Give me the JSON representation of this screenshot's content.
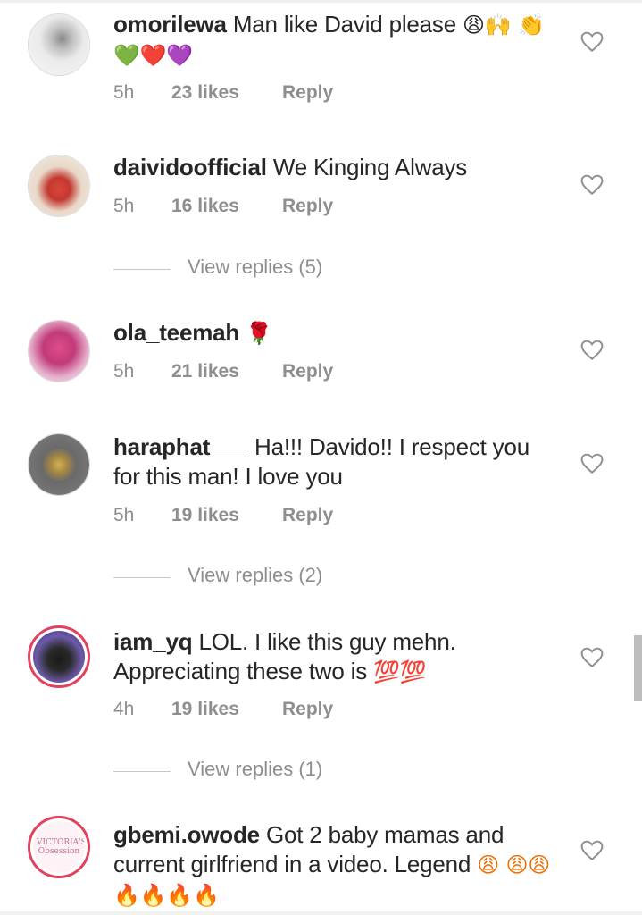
{
  "comments": [
    {
      "username": "omorilewa",
      "text": "Man like David please",
      "emojis": "😩🙌 👏💚❤️💜",
      "time": "5h",
      "likes": "23 likes",
      "reply": "Reply"
    },
    {
      "username": "daividoofficial",
      "text": "We Kinging Always",
      "emojis": "",
      "time": "5h",
      "likes": "16 likes",
      "reply": "Reply",
      "view_replies": "View replies (5)"
    },
    {
      "username": "ola_teemah",
      "text": "",
      "emojis": "🌹",
      "time": "5h",
      "likes": "21 likes",
      "reply": "Reply"
    },
    {
      "username": "haraphat___",
      "text": "Ha!!! Davido!! I respect you for this man! I love you",
      "emojis": "",
      "time": "5h",
      "likes": "19 likes",
      "reply": "Reply",
      "view_replies": "View replies (2)"
    },
    {
      "username": "iam_yq",
      "text": "LOL.  I like this guy mehn. Appreciating these two is",
      "emojis": "💯💯",
      "time": "4h",
      "likes": "19 likes",
      "reply": "Reply",
      "view_replies": "View replies (1)"
    },
    {
      "username": "gbemi.owode",
      "text": "Got 2 baby mamas and current girlfriend in a video. Legend",
      "emojis": "😩 😩😩🔥🔥🔥🔥",
      "time": "",
      "likes": "",
      "reply": "",
      "avatar_text": "VICTORIA'S Obsession"
    }
  ],
  "icons": {
    "heart": "heart-outline-icon"
  },
  "colors": {
    "username": "#262626",
    "meta": "#8e8e8e",
    "story_ring": "#e4405f"
  }
}
